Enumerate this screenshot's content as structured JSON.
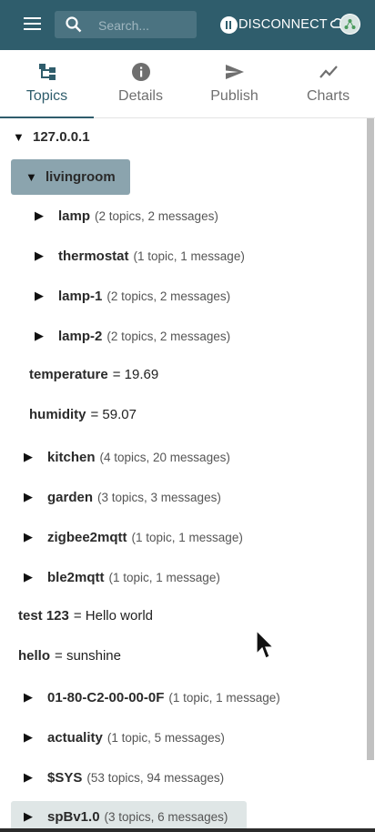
{
  "search": {
    "placeholder": "Search..."
  },
  "connection": {
    "label": "DISCONNECT"
  },
  "tabs": [
    {
      "label": "Topics",
      "icon": "tree-icon"
    },
    {
      "label": "Details",
      "icon": "info-icon"
    },
    {
      "label": "Publish",
      "icon": "send-icon"
    },
    {
      "label": "Charts",
      "icon": "chart-icon"
    }
  ],
  "tree": {
    "root": "127.0.0.1",
    "livingroom": "livingroom",
    "children": [
      {
        "name": "lamp",
        "meta": "(2 topics, 2 messages)"
      },
      {
        "name": "thermostat",
        "meta": "(1 topic, 1 message)"
      },
      {
        "name": "lamp-1",
        "meta": "(2 topics, 2 messages)"
      },
      {
        "name": "lamp-2",
        "meta": "(2 topics, 2 messages)"
      }
    ],
    "values": [
      {
        "name": "temperature",
        "value": "= 19.69"
      },
      {
        "name": "humidity",
        "value": "= 59.07"
      }
    ],
    "groups": [
      {
        "name": "kitchen",
        "meta": "(4 topics, 20 messages)"
      },
      {
        "name": "garden",
        "meta": "(3 topics, 3 messages)"
      },
      {
        "name": "zigbee2mqtt",
        "meta": "(1 topic, 1 message)"
      },
      {
        "name": "ble2mqtt",
        "meta": "(1 topic, 1 message)"
      }
    ],
    "leaves": [
      {
        "name": "test 123",
        "value": "= Hello world"
      },
      {
        "name": "hello",
        "value": "= sunshine"
      }
    ],
    "more": [
      {
        "name": "01-80-C2-00-00-0F",
        "meta": "(1 topic, 1 message)"
      },
      {
        "name": "actuality",
        "meta": "(1 topic, 5 messages)"
      },
      {
        "name": "$SYS",
        "meta": "(53 topics, 94 messages)"
      },
      {
        "name": "spBv1.0",
        "meta": "(3 topics, 6 messages)"
      }
    ]
  },
  "colors": {
    "appbar": "#2f5d6c",
    "selected": "#8ba4ae",
    "accent": "#2f5d6c"
  }
}
